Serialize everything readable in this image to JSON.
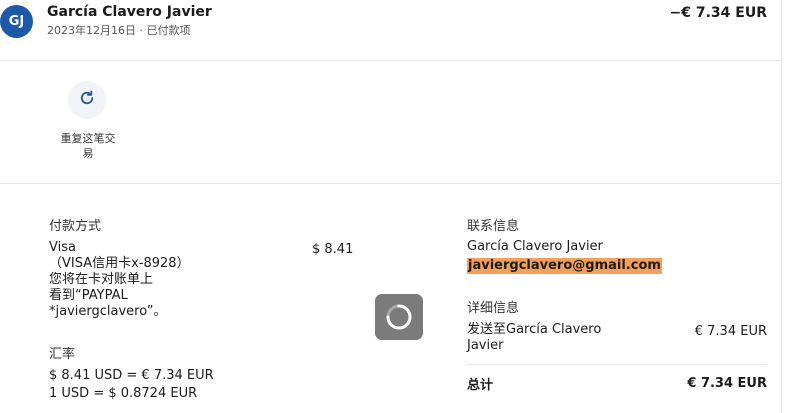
{
  "header": {
    "avatar_initials": "GJ",
    "name": "García Clavero Javier",
    "subtitle": "2023年12月16日 · 已付款项",
    "amount": "−€ 7.34 EUR"
  },
  "actions": {
    "repeat_label": "重复这笔交易",
    "repeat_icon": "refresh-icon"
  },
  "payment": {
    "heading": "付款方式",
    "method_lines": [
      "Visa",
      "（VISA信用卡x-8928）",
      "您将在卡对账单上",
      "看到“PAYPAL",
      "*javiergclavero”。"
    ],
    "amount": "$ 8.41"
  },
  "exchange": {
    "heading": "汇率",
    "line1": "$ 8.41 USD = € 7.34 EUR",
    "line2": "1 USD = $ 0.8724 EUR"
  },
  "contact": {
    "heading": "联系信息",
    "name": "García Clavero Javier",
    "email": "javiergclavero@gmail.com"
  },
  "details": {
    "heading": "详细信息",
    "line_label_1": "发送至García Clavero",
    "line_label_2": "Javier",
    "line_amount": "€ 7.34 EUR",
    "total_label": "总计",
    "total_amount": "€ 7.34 EUR"
  },
  "colors": {
    "avatar": "#1a5aa8",
    "email_highlight": "#f5a05a",
    "loader": "#7b7b7b"
  }
}
